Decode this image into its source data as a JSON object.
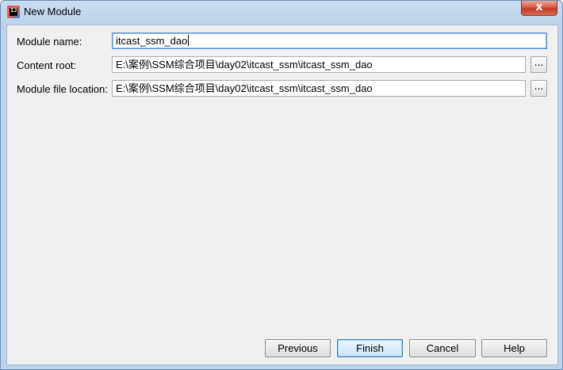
{
  "window": {
    "title": "New Module",
    "app_icon": "intellij-idea-icon",
    "close_label": "x"
  },
  "form": {
    "module_name_label": "Module name:",
    "module_name_value": "itcast_ssm_dao",
    "content_root_label": "Content root:",
    "content_root_value": "E:\\案例\\SSM综合项目\\day02\\itcast_ssm\\itcast_ssm_dao",
    "module_file_location_label": "Module file location:",
    "module_file_location_value": "E:\\案例\\SSM综合项目\\day02\\itcast_ssm\\itcast_ssm_dao",
    "browse_label": "..."
  },
  "buttons": {
    "previous": "Previous",
    "finish": "Finish",
    "cancel": "Cancel",
    "help": "Help"
  }
}
